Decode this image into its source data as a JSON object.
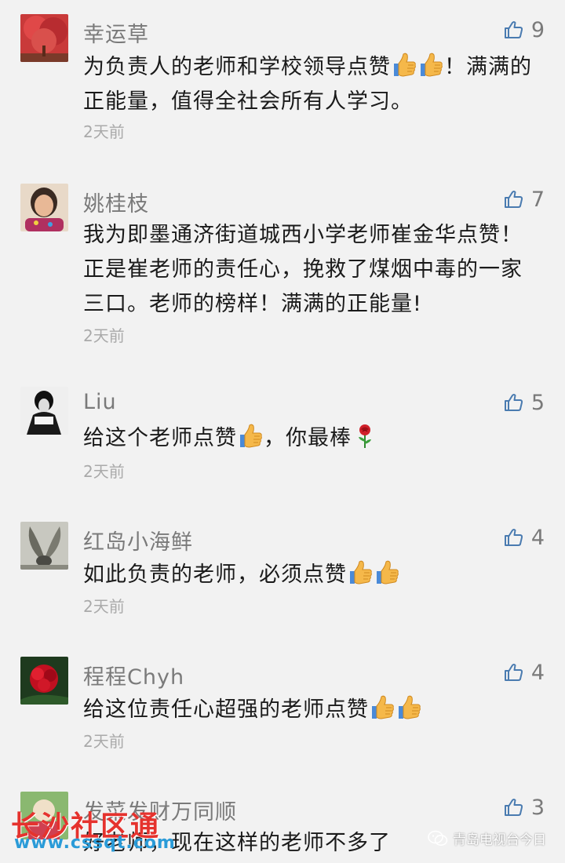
{
  "comments": [
    {
      "name": "幸运草",
      "likes": "9",
      "segments": [
        {
          "t": "text",
          "v": "为负责人的老师和学校领导点赞"
        },
        {
          "t": "emoji",
          "v": "thumbs-up"
        },
        {
          "t": "emoji",
          "v": "thumbs-up"
        },
        {
          "t": "text",
          "v": "！满满的正能量，值得全社会所有人学习。"
        }
      ],
      "time": "2天前"
    },
    {
      "name": "姚桂枝",
      "likes": "7",
      "segments": [
        {
          "t": "text",
          "v": "我为即墨通济街道城西小学老师崔金华点赞！正是崔老师的责任心，挽救了煤烟中毒的一家三口。老师的榜样！满满的正能量!"
        }
      ],
      "time": "2天前"
    },
    {
      "name": "Liu",
      "likes": "5",
      "segments": [
        {
          "t": "text",
          "v": "给这个老师点赞"
        },
        {
          "t": "emoji",
          "v": "thumbs-up"
        },
        {
          "t": "text",
          "v": "，你最棒"
        },
        {
          "t": "emoji",
          "v": "rose"
        }
      ],
      "time": "2天前"
    },
    {
      "name": "红岛小海鲜",
      "likes": "4",
      "segments": [
        {
          "t": "text",
          "v": "如此负责的老师，必须点赞"
        },
        {
          "t": "emoji",
          "v": "thumbs-up"
        },
        {
          "t": "emoji",
          "v": "thumbs-up"
        }
      ],
      "time": "2天前"
    },
    {
      "name": "程程Chyh",
      "likes": "4",
      "segments": [
        {
          "t": "text",
          "v": "给这位责任心超强的老师点赞"
        },
        {
          "t": "emoji",
          "v": "thumbs-up"
        },
        {
          "t": "emoji",
          "v": "thumbs-up"
        }
      ],
      "time": "2天前"
    },
    {
      "name": "发菜发财万同顺",
      "likes": "3",
      "segments": [
        {
          "t": "text",
          "v": "好老师，现在这样的老师不多了"
        }
      ],
      "time": ""
    }
  ],
  "icons": {
    "like": "thumb-up-outline-icon",
    "emoji_thumb": "thumbs-up-emoji",
    "emoji_rose": "rose-emoji"
  },
  "watermark_left": {
    "text": "长沙社区通",
    "url": "www.cssqt.com"
  },
  "watermark_right": {
    "text": "青岛电视台今日"
  },
  "colors": {
    "background": "#f2f2f2",
    "name": "#7a7a7a",
    "text": "#1a1a1a",
    "time": "#aaaaaa",
    "like_icon": "#4a7bb0"
  }
}
